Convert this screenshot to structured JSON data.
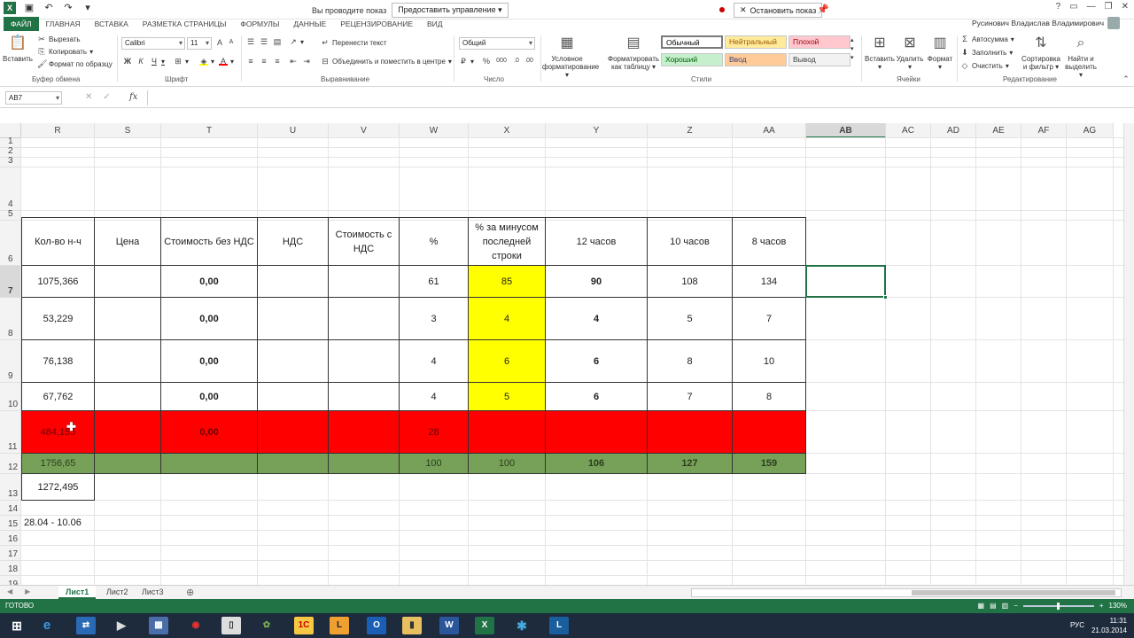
{
  "colors": {
    "accent": "#217346",
    "yellow": "#ffff00",
    "red": "#ff0000",
    "green": "#77a158",
    "taskbar": "#1d2b3d"
  },
  "titlebar": {
    "presenting_label": "Вы проводите показ",
    "give_control": "Предоставить управление",
    "stop_show": "Остановить показ",
    "user": "Русинович Владислав Владимирович"
  },
  "tabs": [
    "ФАЙЛ",
    "ГЛАВНАЯ",
    "ВСТАВКА",
    "РАЗМЕТКА СТРАНИЦЫ",
    "ФОРМУЛЫ",
    "ДАННЫЕ",
    "РЕЦЕНЗИРОВАНИЕ",
    "ВИД"
  ],
  "ribbon": {
    "paste": "Вставить",
    "cut": "Вырезать",
    "copy": "Копировать",
    "format_painter": "Формат по образцу",
    "clipboard_group": "Буфер обмена",
    "font_name": "Calibri",
    "font_size": "11",
    "font_group": "Шрифт",
    "wrap_text": "Перенести текст",
    "merge_center": "Объединить и поместить в центре",
    "align_group": "Выравнивание",
    "number_format": "Общий",
    "number_group": "Число",
    "cond_format_1": "Условное",
    "cond_format_2": "форматирование",
    "format_table_1": "Форматировать",
    "format_table_2": "как таблицу",
    "styles": [
      {
        "label": "Обычный",
        "bg": "#ffffff",
        "fg": "#000000"
      },
      {
        "label": "Нейтральный",
        "bg": "#ffeb9c",
        "fg": "#9c5700"
      },
      {
        "label": "Плохой",
        "bg": "#ffc7ce",
        "fg": "#9c0006"
      },
      {
        "label": "Хороший",
        "bg": "#c6efce",
        "fg": "#006100"
      },
      {
        "label": "Ввод",
        "bg": "#ffcc99",
        "fg": "#3f3f76"
      },
      {
        "label": "Вывод",
        "bg": "#f2f2f2",
        "fg": "#3f3f3f"
      }
    ],
    "styles_group": "Стили",
    "insert": "Вставить",
    "delete": "Удалить",
    "format": "Формат",
    "cells_group": "Ячейки",
    "autosum": "Автосумма",
    "fill": "Заполнить",
    "clear": "Очистить",
    "sort_1": "Сортировка",
    "sort_2": "и фильтр",
    "find_1": "Найти и",
    "find_2": "выделить",
    "edit_group": "Редактирование"
  },
  "formula_bar": {
    "name_box": "AB7",
    "fx": "fx"
  },
  "columns": [
    {
      "id": "R",
      "w": 83
    },
    {
      "id": "S",
      "w": 75
    },
    {
      "id": "T",
      "w": 109
    },
    {
      "id": "U",
      "w": 80
    },
    {
      "id": "V",
      "w": 80
    },
    {
      "id": "W",
      "w": 78
    },
    {
      "id": "X",
      "w": 87
    },
    {
      "id": "Y",
      "w": 115
    },
    {
      "id": "Z",
      "w": 96
    },
    {
      "id": "AA",
      "w": 83
    },
    {
      "id": "AB",
      "w": 90
    },
    {
      "id": "AC",
      "w": 51
    },
    {
      "id": "AD",
      "w": 51
    },
    {
      "id": "AE",
      "w": 51
    },
    {
      "id": "AF",
      "w": 51
    },
    {
      "id": "AG",
      "w": 53
    }
  ],
  "selected_column": "AB",
  "rows": [
    {
      "id": "1",
      "h": 11
    },
    {
      "id": "2",
      "h": 11
    },
    {
      "id": "3",
      "h": 11
    },
    {
      "id": "4",
      "h": 49
    },
    {
      "id": "5",
      "h": 11
    },
    {
      "id": "6",
      "h": 51
    },
    {
      "id": "7",
      "h": 36
    },
    {
      "id": "8",
      "h": 48
    },
    {
      "id": "9",
      "h": 48
    },
    {
      "id": "10",
      "h": 32
    },
    {
      "id": "11",
      "h": 48
    },
    {
      "id": "12",
      "h": 23
    },
    {
      "id": "13",
      "h": 30
    },
    {
      "id": "14",
      "h": 17
    },
    {
      "id": "15",
      "h": 17
    },
    {
      "id": "16",
      "h": 17
    },
    {
      "id": "17",
      "h": 17
    },
    {
      "id": "18",
      "h": 17
    },
    {
      "id": "19",
      "h": 17
    }
  ],
  "table": {
    "headers": [
      "Кол-во н-ч",
      "Цена",
      "Стоимость без НДС",
      "НДС",
      "Стоимость с НДС",
      "%",
      "% за минусом последней строки",
      "12 часов",
      "10 часов",
      "8 часов"
    ],
    "rows": [
      {
        "cells": [
          "1075,366",
          "",
          "0,00",
          "",
          "",
          "61",
          "85",
          "90",
          "108",
          "134"
        ],
        "fill": ""
      },
      {
        "cells": [
          "53,229",
          "",
          "0,00",
          "",
          "",
          "3",
          "4",
          "4",
          "5",
          "7"
        ],
        "fill": ""
      },
      {
        "cells": [
          "76,138",
          "",
          "0,00",
          "",
          "",
          "4",
          "6",
          "6",
          "8",
          "10"
        ],
        "fill": ""
      },
      {
        "cells": [
          "67,762",
          "",
          "0,00",
          "",
          "",
          "4",
          "5",
          "6",
          "7",
          "8"
        ],
        "fill": ""
      },
      {
        "cells": [
          "484,155",
          "",
          "0,00",
          "",
          "",
          "28",
          "",
          "",
          "",
          ""
        ],
        "fill": "red"
      },
      {
        "cells": [
          "1756,65",
          "",
          "",
          "",
          "",
          "100",
          "100",
          "106",
          "127",
          "159"
        ],
        "fill": "green"
      }
    ],
    "extra_value": "1272,495",
    "date_range": "28.04 - 10.06"
  },
  "sheets": [
    "Лист1",
    "Лист2",
    "Лист3"
  ],
  "status": {
    "ready": "ГОТОВО",
    "zoom": "130%",
    "time": "11:31",
    "date": "21.03.2014",
    "lang": "РУС"
  }
}
